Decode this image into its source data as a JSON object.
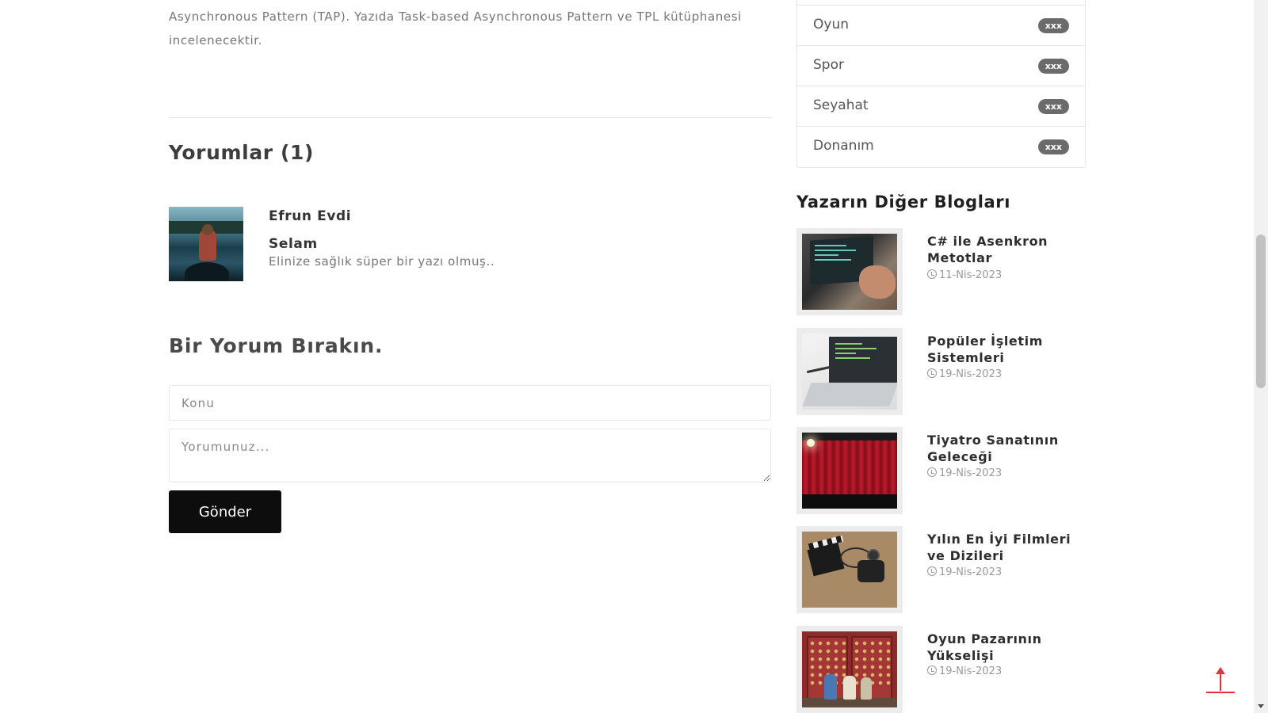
{
  "article": {
    "intro_line_1": "Asynchronous Pattern (TAP). Yazıda Task-based Asynchronous Pattern ve TPL kütüphanesi",
    "intro_line_2": "incelenecektir."
  },
  "comments": {
    "title": "Yorumlar (1)",
    "items": [
      {
        "author": "Efrun Evdi",
        "subject": "Selam",
        "body": "Elinize sağlık süper bir yazı olmuş.."
      }
    ]
  },
  "comment_form": {
    "title": "Bir Yorum Bırakın.",
    "subject_placeholder": "Konu",
    "comment_placeholder": "Yorumunuz...",
    "submit_label": "Gönder"
  },
  "categories": [
    {
      "label": "Oyun",
      "badge": "xxx"
    },
    {
      "label": "Spor",
      "badge": "xxx"
    },
    {
      "label": "Seyahat",
      "badge": "xxx"
    },
    {
      "label": "Donanım",
      "badge": "xxx"
    }
  ],
  "other_blogs": {
    "title": "Yazarın Diğer Blogları",
    "items": [
      {
        "title": "C# ile Asenkron Metotlar",
        "date": "11-Nis-2023"
      },
      {
        "title": "Popüler İşletim Sistemleri",
        "date": "19-Nis-2023"
      },
      {
        "title": "Tiyatro Sanatının Geleceği",
        "date": "19-Nis-2023"
      },
      {
        "title": "Yılın En İyi Filmleri ve Dizileri",
        "date": "19-Nis-2023"
      },
      {
        "title": "Oyun Pazarının Yükselişi",
        "date": "19-Nis-2023"
      }
    ]
  },
  "colors": {
    "accent_arrow": "#e2323f",
    "button_bg": "#0d0d0d",
    "badge_bg": "#6b6b6b"
  },
  "icons": [
    "clock-icon",
    "arrow-up-icon"
  ]
}
